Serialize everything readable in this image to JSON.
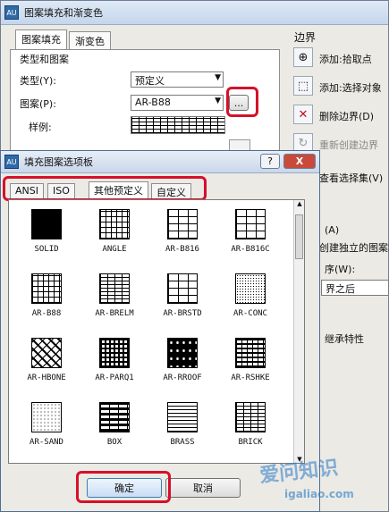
{
  "back_window": {
    "title": "图案填充和渐变色",
    "app_icon": "AU",
    "tabs": [
      "图案填充",
      "渐变色"
    ],
    "group_title": "类型和图案",
    "type_label": "类型(Y):",
    "type_value": "预定义",
    "pattern_label": "图案(P):",
    "pattern_value": "AR-B88",
    "browse_button": "...",
    "sample_label": "样例:",
    "boundary_title": "边界",
    "boundary_items": [
      "添加:拾取点",
      "添加:选择对象",
      "删除边界(D)",
      "重新创建边界",
      "查看选择集(V)"
    ],
    "side_texts": [
      "(A)",
      "创建独立的图案填",
      "序(W):",
      "界之后",
      "继承特性"
    ]
  },
  "front_dialog": {
    "title": "填充图案选项板",
    "help_button": "?",
    "close_button": "X",
    "tabs": [
      "ANSI",
      "ISO",
      "其他预定义",
      "自定义"
    ],
    "patterns": [
      {
        "name": "SOLID",
        "icon": "solid-pattern-icon"
      },
      {
        "name": "ANGLE",
        "icon": "angle-pattern-icon"
      },
      {
        "name": "AR-B816",
        "icon": "brick-pattern-icon"
      },
      {
        "name": "AR-B816C",
        "icon": "brick-pattern-icon"
      },
      {
        "name": "AR-B88",
        "icon": "brick-pattern-icon"
      },
      {
        "name": "AR-BRELM",
        "icon": "brick-pattern-icon"
      },
      {
        "name": "AR-BRSTD",
        "icon": "brick-pattern-icon"
      },
      {
        "name": "AR-CONC",
        "icon": "concrete-pattern-icon"
      },
      {
        "name": "AR-HBONE",
        "icon": "herringbone-pattern-icon"
      },
      {
        "name": "AR-PARQ1",
        "icon": "parquet-pattern-icon"
      },
      {
        "name": "AR-RROOF",
        "icon": "roof-pattern-icon"
      },
      {
        "name": "AR-RSHKE",
        "icon": "shake-pattern-icon"
      },
      {
        "name": "AR-SAND",
        "icon": "sand-pattern-icon"
      },
      {
        "name": "BOX",
        "icon": "box-pattern-icon"
      },
      {
        "name": "BRASS",
        "icon": "brass-pattern-icon"
      },
      {
        "name": "BRICK",
        "icon": "brick-pattern-icon"
      }
    ],
    "ok_button": "确定",
    "cancel_button": "取消"
  },
  "colors": {
    "highlight": "#d6102a"
  },
  "watermark": {
    "brand": "爱问知识",
    "site": "igaliao.com"
  }
}
